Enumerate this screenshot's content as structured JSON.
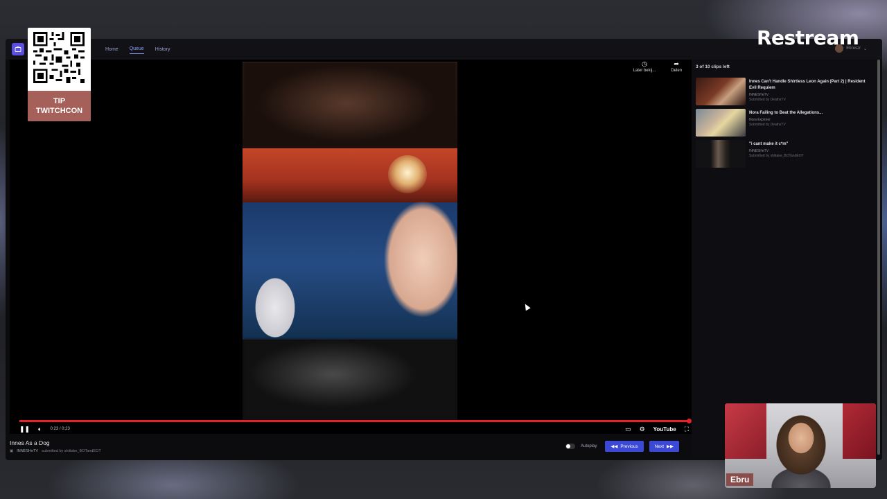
{
  "nav": {
    "links": [
      "Home",
      "Queue",
      "History"
    ],
    "active": "Queue",
    "user": "Ebruszr"
  },
  "overlay_actions": {
    "watch_later": "Later bekij...",
    "share": "Delen"
  },
  "player": {
    "current_time": "0:23 / 0:23",
    "progress": 1.0,
    "youtube_label": "YouTube"
  },
  "clip": {
    "title": "Innes As a Dog",
    "channel": "INNESHeTV",
    "submitted": "submitted by shiitake_BOTandEOT"
  },
  "bottom_controls": {
    "autoplay": "Autoplay",
    "previous": "Previous",
    "next": "Next"
  },
  "queue": {
    "clips_left": "3 of 10 clips left",
    "items": [
      {
        "title": "Innes Can't Handle Shirtless Leon Again (Part 2) | Resident Evil Requiem",
        "channel": "INNESHeTV",
        "submitted": "Submitted by DeathsTV"
      },
      {
        "title": "Nora Failing to Beat the Allegations...",
        "channel": "Nora Explorer",
        "submitted": "Submitted by DeathsTV"
      },
      {
        "title": "\"i cant make it c*m\"",
        "channel": "INNESHeTV",
        "submitted": "Submitted by shiitake_BOTandEOT"
      }
    ]
  },
  "qr_card": {
    "label_line1": "TIP",
    "label_line2": "TWITCHCON"
  },
  "brand": "Restream",
  "webcam": {
    "name": "Ebru"
  },
  "colors": {
    "accent": "#3b49d6",
    "progress": "#e8202a",
    "name_tag": "#8a4d49"
  }
}
